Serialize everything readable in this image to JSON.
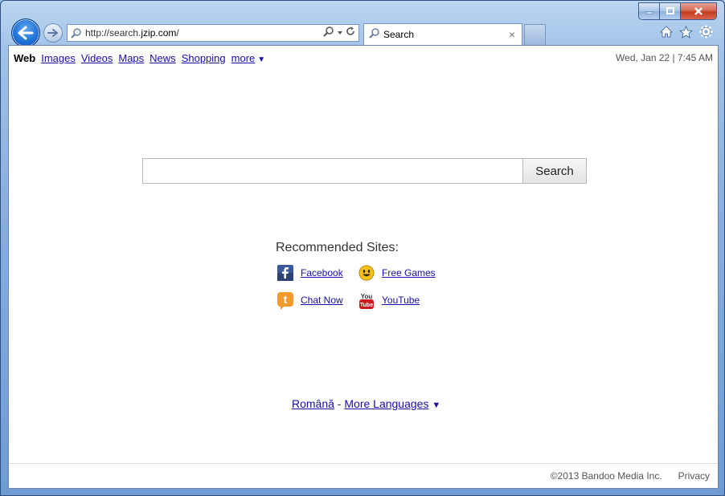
{
  "browser": {
    "address_url_prefix": "http://search.",
    "address_url_domain": "jzip.com",
    "address_url_suffix": "/",
    "tab_title": "Search",
    "tab_close_glyph": "×",
    "minimize_glyph": "▁",
    "close_glyph": "✕"
  },
  "nav": {
    "active": "Web",
    "links": [
      "Images",
      "Videos",
      "Maps",
      "News",
      "Shopping"
    ],
    "more_label": "more",
    "caret": "▼",
    "datetime": "Wed, Jan 22 | 7:45 AM"
  },
  "search": {
    "input_value": "",
    "button_label": "Search"
  },
  "recommended": {
    "title": "Recommended Sites:",
    "sites": [
      {
        "label": "Facebook",
        "icon": "facebook-icon"
      },
      {
        "label": "Free Games",
        "icon": "smiley-icon"
      },
      {
        "label": "Chat Now",
        "icon": "chat-t-icon"
      },
      {
        "label": "YouTube",
        "icon": "youtube-icon"
      }
    ]
  },
  "languages": {
    "current": "Română",
    "separator": " - ",
    "more_label": "More Languages",
    "caret": "▼"
  },
  "footer": {
    "copyright": "©2013 Bandoo Media Inc.",
    "privacy": "Privacy"
  },
  "colors": {
    "link": "#1a0dab",
    "frame": "#89b0de",
    "back_button": "#1d6fd6"
  }
}
